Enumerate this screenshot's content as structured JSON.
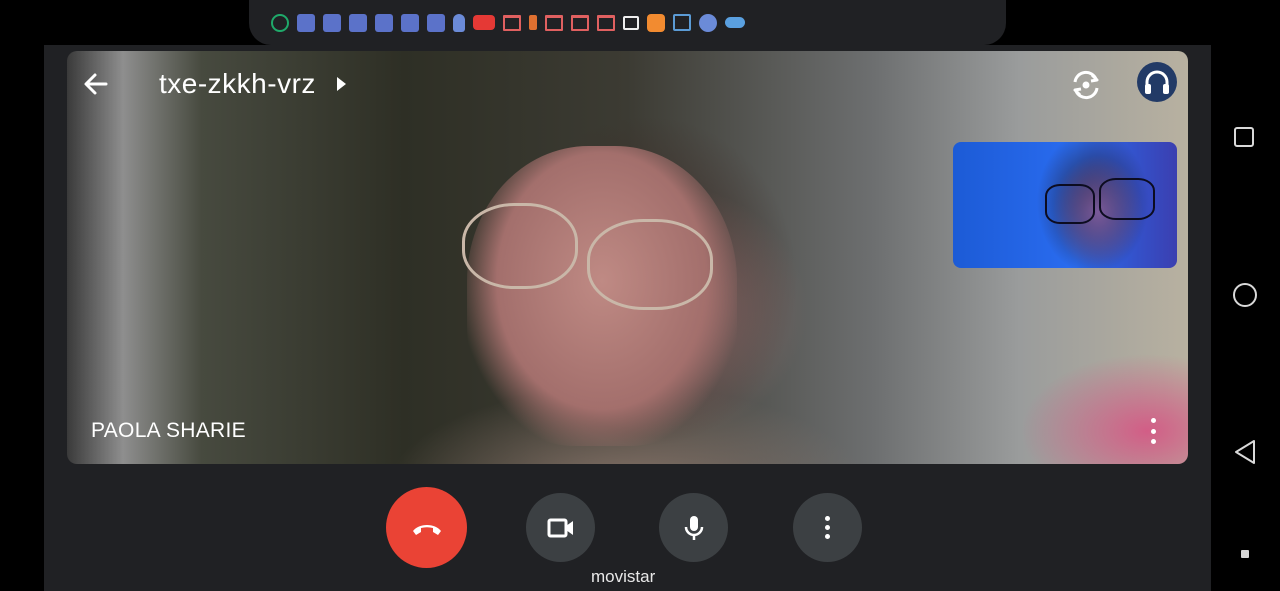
{
  "meeting": {
    "code": "txe-zkkh-vrz",
    "participant_name": "PAOLA SHARIE"
  },
  "status_bar": {
    "notification_icons": [
      "whatsapp-business-icon",
      "facebook-icon",
      "facebook-icon",
      "facebook-icon",
      "facebook-icon",
      "facebook-icon",
      "facebook-icon",
      "touch-hand-icon",
      "youtube-icon",
      "gmail-icon",
      "battery-saver-icon",
      "gmail-icon",
      "gmail-icon",
      "gmail-icon",
      "video-camera-icon",
      "orange-app-icon",
      "gallery-icon",
      "fan-icon",
      "cloud-icon"
    ]
  },
  "footer": {
    "carrier": "movistar"
  },
  "colors": {
    "end_call": "#ea4335",
    "control_bg": "#3c4043",
    "app_bg": "#202124",
    "audio_btn_bg": "#223a66"
  }
}
